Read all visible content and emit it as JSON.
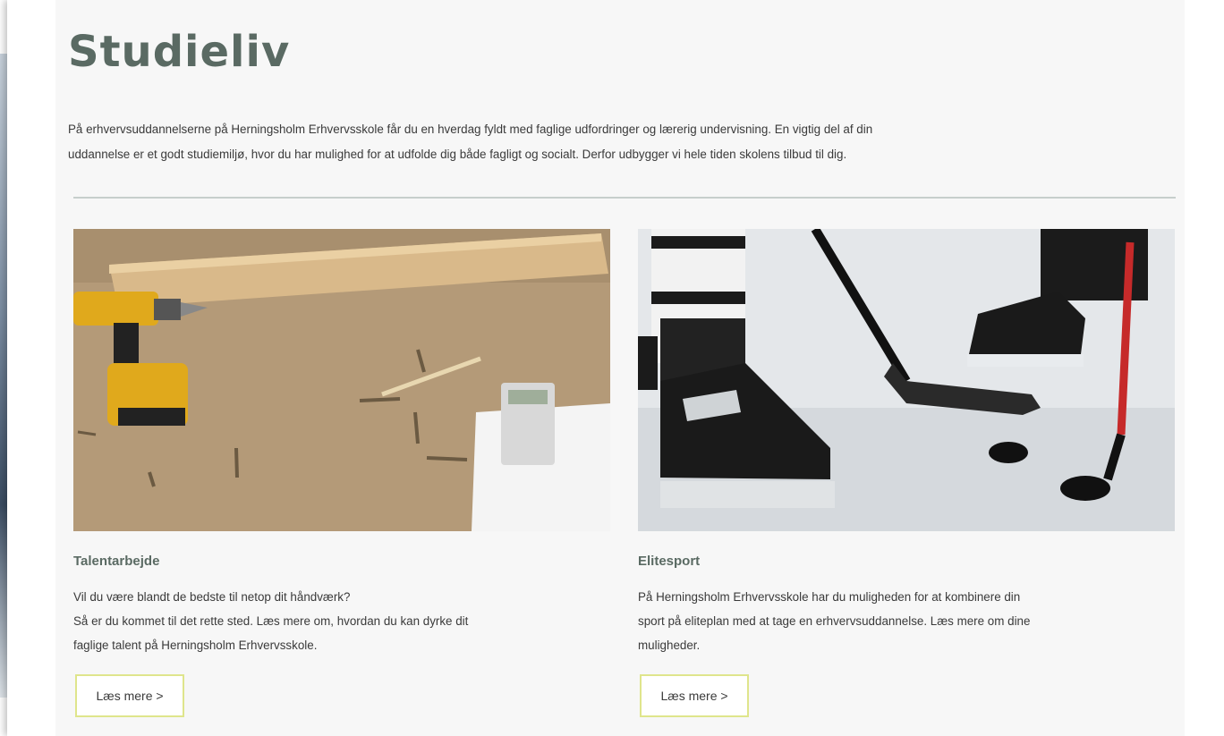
{
  "page": {
    "title": "Studieliv",
    "intro_line1": "På erhvervsuddannelserne på Herningsholm Erhvervsskole får du en hverdag fyldt med faglige udfordringer og lærerig undervisning. En vigtig del af din",
    "intro_line2": "uddannelse er et godt studiemiljø, hvor du har mulighed for at udfolde dig både fagligt og socialt. Derfor udbygger vi hele tiden skolens tilbud til dig."
  },
  "cards": [
    {
      "title": "Talentarbejde",
      "lines": [
        "Vil du være blandt de bedste til netop dit håndværk?",
        "Så er du kommet til det rette sted. Læs mere om, hvordan du kan dyrke dit",
        "faglige talent på Herningsholm Erhvervsskole."
      ],
      "button": "Læs mere >"
    },
    {
      "title": "Elitesport",
      "lines": [
        "På Herningsholm Erhvervsskole har du muligheden for at kombinere din",
        "sport på eliteplan med at tage en erhvervsuddannelse. Læs mere om dine",
        "muligheder."
      ],
      "button": "Læs mere >"
    }
  ],
  "colors": {
    "title": "#5a6a63",
    "button_border": "#dfe58c",
    "rule": "#c7cfcc"
  }
}
